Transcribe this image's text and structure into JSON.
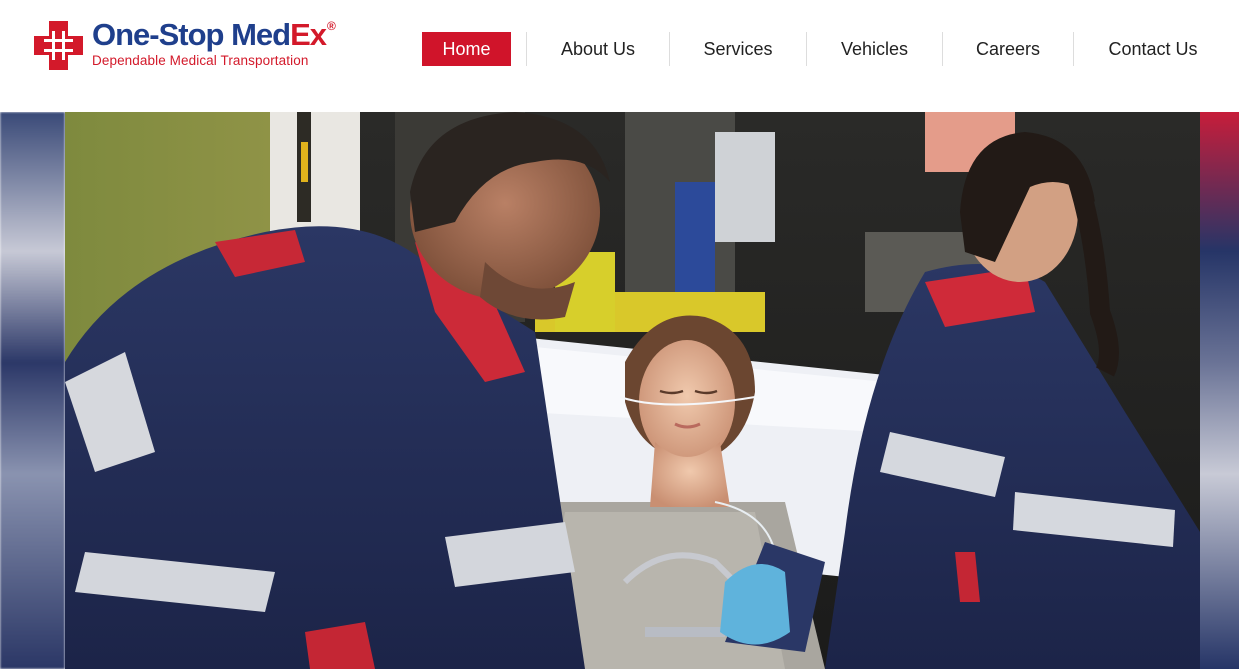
{
  "brand": {
    "name_main": "One-Stop Med",
    "name_accent": "Ex",
    "registered": "®",
    "tagline": "Dependable Medical Transportation",
    "colors": {
      "navy": "#1f3f8c",
      "red": "#d3192a"
    }
  },
  "nav": {
    "items": [
      {
        "label": "Home",
        "active": true
      },
      {
        "label": "About Us",
        "active": false
      },
      {
        "label": "Services",
        "active": false
      },
      {
        "label": "Vehicles",
        "active": false
      },
      {
        "label": "Careers",
        "active": false
      },
      {
        "label": "Contact Us",
        "active": false
      }
    ],
    "active_color": "#d0142a"
  },
  "hero": {
    "image": "paramedics-loading-patient-on-stretcher-into-ambulance"
  }
}
